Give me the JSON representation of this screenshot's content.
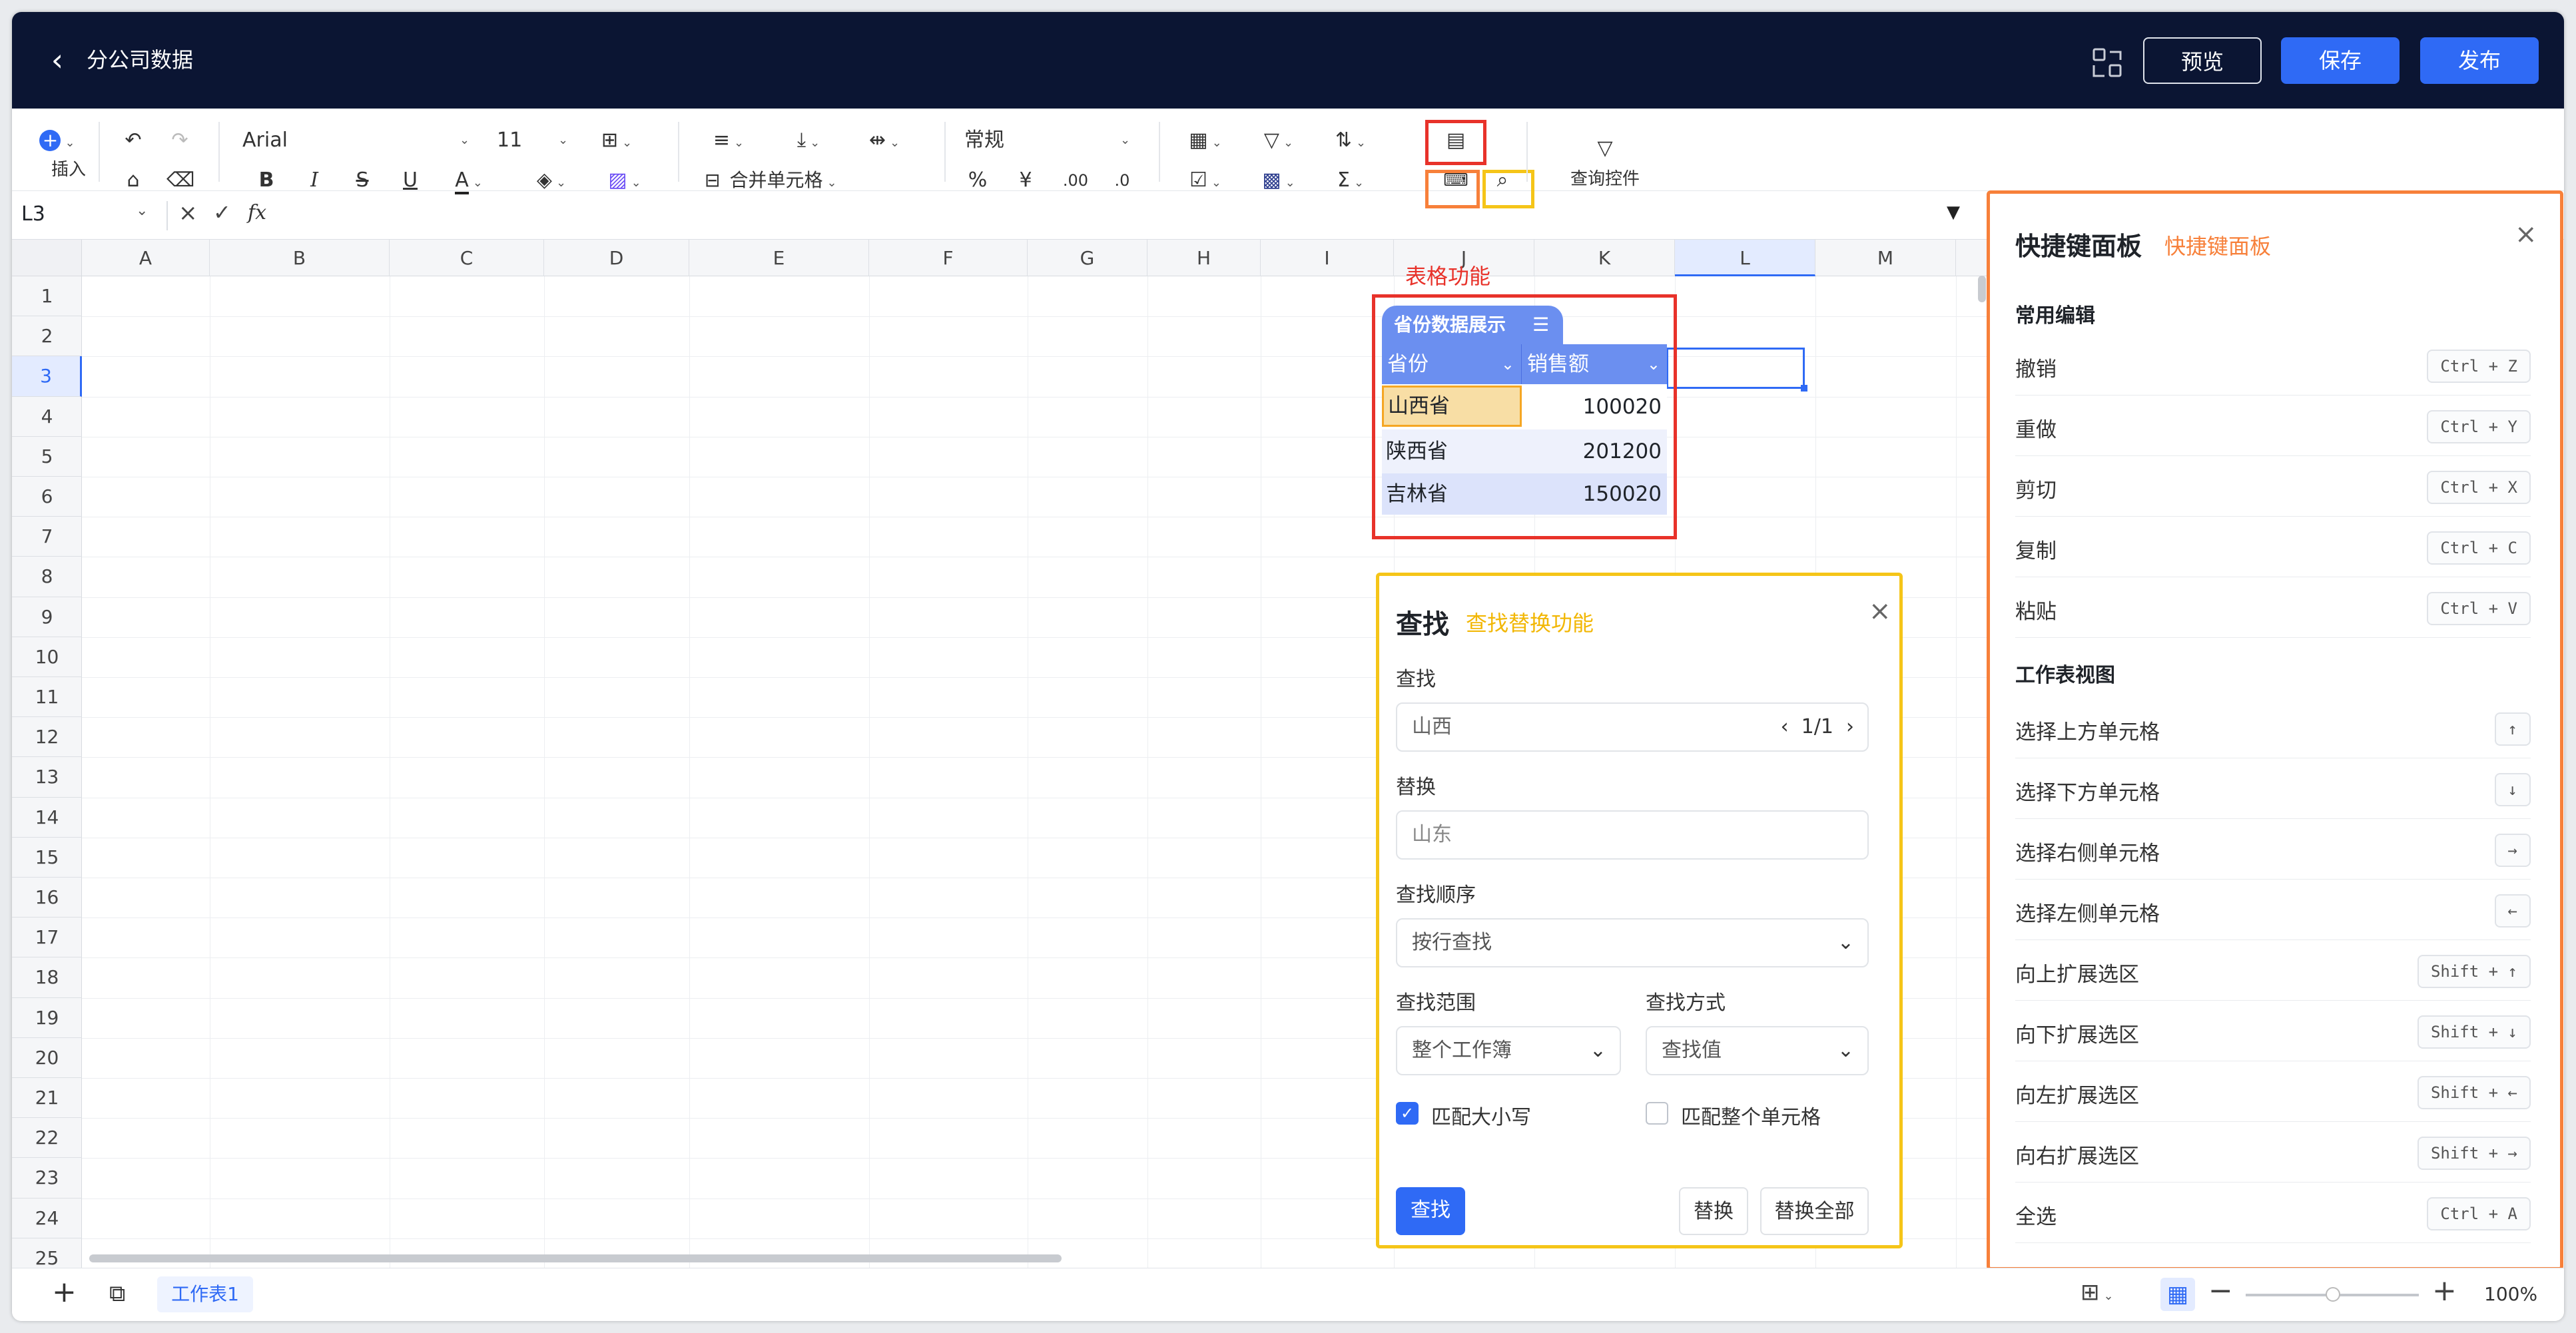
{
  "topbar": {
    "title": "分公司数据",
    "preview": "预览",
    "save": "保存",
    "publish": "发布"
  },
  "toolbar": {
    "insert": "插入",
    "font": "Arial",
    "font_size": "11",
    "merge": "合并单元格",
    "number_format": "常规",
    "query_control": "查询控件"
  },
  "formula": {
    "cell_ref": "L3",
    "fx": "fx"
  },
  "columns": [
    "A",
    "B",
    "C",
    "D",
    "E",
    "F",
    "G",
    "H",
    "I",
    "J",
    "K",
    "L",
    "M"
  ],
  "rows": [
    "1",
    "2",
    "3",
    "4",
    "5",
    "6",
    "7",
    "8",
    "9",
    "10",
    "11",
    "12",
    "13",
    "14",
    "15",
    "16",
    "17",
    "18",
    "19",
    "20",
    "21",
    "22",
    "23",
    "24",
    "25"
  ],
  "table": {
    "annotation": "表格功能",
    "name": "省份数据展示",
    "headers": [
      "省份",
      "销售额"
    ],
    "rows": [
      {
        "province": "山西省",
        "sales": "100020"
      },
      {
        "province": "陕西省",
        "sales": "201200"
      },
      {
        "province": "吉林省",
        "sales": "150020"
      }
    ]
  },
  "find": {
    "title": "查找",
    "annotation": "查找替换功能",
    "find_label": "查找",
    "find_value": "山西",
    "find_count": "1/1",
    "replace_label": "替换",
    "replace_placeholder": "山东",
    "order_label": "查找顺序",
    "order_value": "按行查找",
    "scope_label": "查找范围",
    "scope_value": "整个工作簿",
    "mode_label": "查找方式",
    "mode_value": "查找值",
    "match_case": "匹配大小写",
    "match_cell": "匹配整个单元格",
    "find_button": "查找",
    "replace_button": "替换",
    "replace_all_button": "替换全部"
  },
  "shortcut": {
    "title": "快捷键面板",
    "annotation": "快捷键面板",
    "group1": "常用编辑",
    "group2": "工作表视图",
    "items": [
      {
        "name": "撤销",
        "key": "Ctrl + Z"
      },
      {
        "name": "重做",
        "key": "Ctrl + Y"
      },
      {
        "name": "剪切",
        "key": "Ctrl + X"
      },
      {
        "name": "复制",
        "key": "Ctrl + C"
      },
      {
        "name": "粘贴",
        "key": "Ctrl + V"
      },
      {
        "name": "选择上方单元格",
        "key": "↑"
      },
      {
        "name": "选择下方单元格",
        "key": "↓"
      },
      {
        "name": "选择右侧单元格",
        "key": "→"
      },
      {
        "name": "选择左侧单元格",
        "key": "←"
      },
      {
        "name": "向上扩展选区",
        "key": "Shift + ↑"
      },
      {
        "name": "向下扩展选区",
        "key": "Shift + ↓"
      },
      {
        "name": "向左扩展选区",
        "key": "Shift + ←"
      },
      {
        "name": "向右扩展选区",
        "key": "Shift + →"
      },
      {
        "name": "全选",
        "key": "Ctrl + A"
      }
    ]
  },
  "bottom": {
    "sheet_tab": "工作表1",
    "zoom": "100%"
  },
  "colors": {
    "accent": "#2f6af5",
    "header_bg": "#0b1533",
    "red": "#e8322a",
    "orange": "#f7803a",
    "yellow": "#f5c518"
  }
}
